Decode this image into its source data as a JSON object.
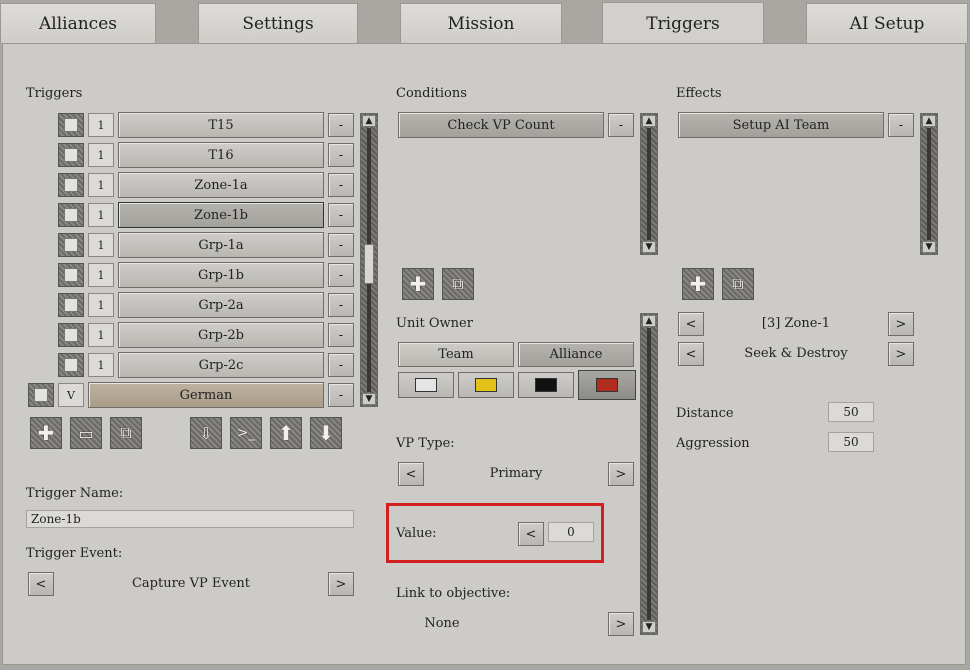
{
  "tabs": [
    "Alliances",
    "Settings",
    "Mission",
    "Triggers",
    "AI Setup"
  ],
  "active_tab": "Triggers",
  "triggers": {
    "heading": "Triggers",
    "items": [
      {
        "num": "1",
        "label": "T15"
      },
      {
        "num": "1",
        "label": "T16"
      },
      {
        "num": "1",
        "label": "Zone-1a"
      },
      {
        "num": "1",
        "label": "Zone-1b"
      },
      {
        "num": "1",
        "label": "Grp-1a"
      },
      {
        "num": "1",
        "label": "Grp-1b"
      },
      {
        "num": "1",
        "label": "Grp-2a"
      },
      {
        "num": "1",
        "label": "Grp-2b"
      },
      {
        "num": "1",
        "label": "Grp-2c"
      }
    ],
    "group": {
      "num": "V",
      "label": "German"
    },
    "minus": "-",
    "name_label": "Trigger Name:",
    "name_value": "Zone-1b",
    "event_label": "Trigger Event:",
    "event_value": "Capture VP Event",
    "prev": "<",
    "next": ">"
  },
  "conditions": {
    "heading": "Conditions",
    "items": [
      "Check VP Count"
    ],
    "minus": "-",
    "unit_owner_label": "Unit Owner",
    "team_label": "Team",
    "alliance_label": "Alliance",
    "colors": [
      "#e4e4e4",
      "#e2c21a",
      "#111111",
      "#b32c22"
    ],
    "vp_type_label": "VP Type:",
    "vp_type_value": "Primary",
    "value_label": "Value:",
    "value_value": "0",
    "link_label": "Link to objective:",
    "link_value": "None",
    "prev": "<",
    "next": ">"
  },
  "effects": {
    "heading": "Effects",
    "items": [
      "Setup AI Team"
    ],
    "minus": "-",
    "zone_value": "[3] Zone-1",
    "mode_value": "Seek & Destroy",
    "distance_label": "Distance",
    "distance_value": "50",
    "aggression_label": "Aggression",
    "aggression_value": "50",
    "prev": "<",
    "next": ">"
  }
}
